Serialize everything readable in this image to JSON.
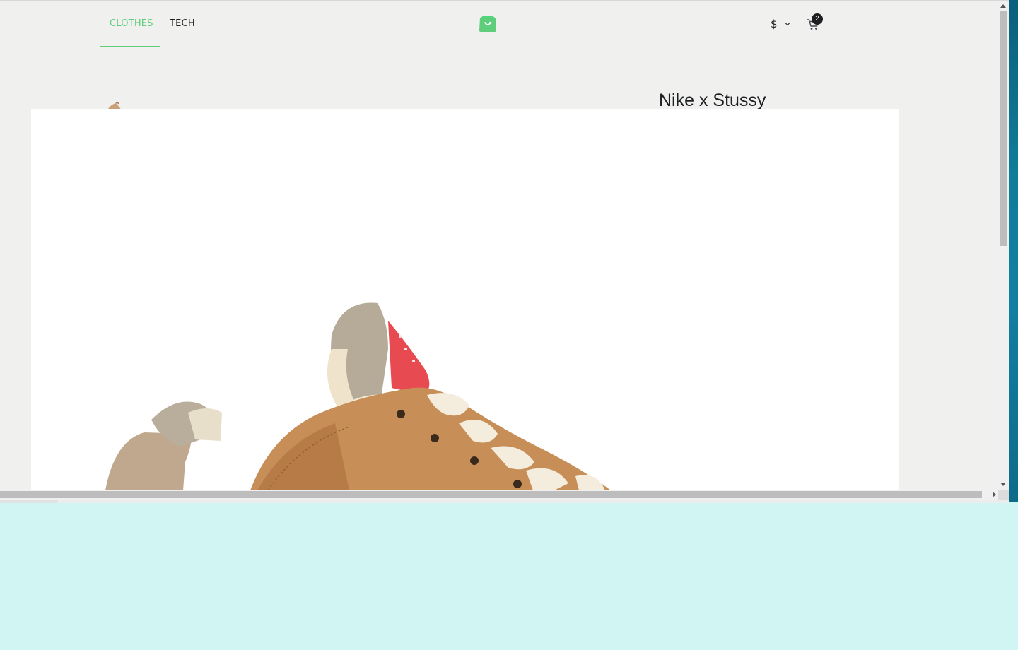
{
  "nav": {
    "tabs": [
      {
        "label": "CLOTHES",
        "active": true
      },
      {
        "label": "TECH",
        "active": false
      }
    ]
  },
  "logo": {
    "icon": "shopping-bag-icon",
    "color": "#5ECE7B"
  },
  "actions": {
    "currency_symbol": "$",
    "currency_icon": "chevron-down-icon",
    "cart_icon": "cart-icon",
    "cart_count": "2"
  },
  "product": {
    "title": "Nike x Stussy"
  },
  "colors": {
    "accent": "#5ECE7B",
    "text": "#1D1F22",
    "page_bg": "#F0F0EF",
    "overlay_bg": "#FFFFFF",
    "desktop_bg": "#D0F5F2"
  }
}
